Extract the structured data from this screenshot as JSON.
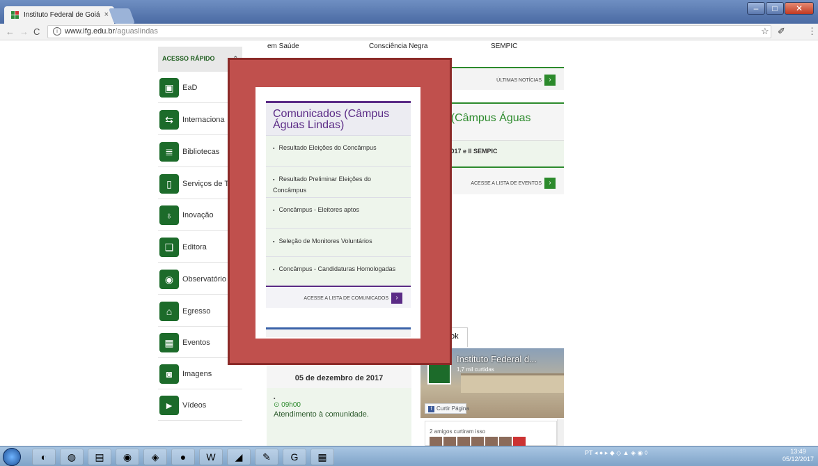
{
  "browser": {
    "tab_title": "Instituto Federal de Goiá",
    "tab_close": "×",
    "url_domain": "www.ifg.edu.br",
    "url_path": "/aguaslindas",
    "back": "←",
    "forward": "→",
    "reload": "C",
    "info": "i",
    "star": "☆",
    "menu": "⋮"
  },
  "top_text": {
    "col1": "em Saúde",
    "col2": "Consciência Negra",
    "col3": "SEMPIC"
  },
  "sidebar": {
    "header": "ACESSO RÁPIDO",
    "caret": "⌃",
    "items": [
      {
        "label": "EaD",
        "icon": "▣"
      },
      {
        "label": "Internaciona",
        "icon": "⇆"
      },
      {
        "label": "Bibliotecas",
        "icon": "≣"
      },
      {
        "label": "Serviços de T",
        "icon": "▯"
      },
      {
        "label": "Inovação",
        "icon": "♁"
      },
      {
        "label": "Editora",
        "icon": "❑"
      },
      {
        "label": "Observatório",
        "icon": "◉"
      },
      {
        "label": "Egresso",
        "icon": "⌂"
      },
      {
        "label": "Eventos",
        "icon": "▦"
      },
      {
        "label": "Imagens",
        "icon": "◙"
      },
      {
        "label": "Vídeos",
        "icon": "►"
      }
    ]
  },
  "noticias": {
    "link": "ÚLTIMAS NOTÍCIAS",
    "arrow": "›"
  },
  "eventos": {
    "title": "tos (Câmpus Águas\ns)",
    "item": "TEC 2017 e II SEMPIC",
    "link": "ACESSE A LISTA DE EVENTOS",
    "arrow": "›"
  },
  "comunicados": {
    "title": "Comunicados (Câmpus Águas Lindas)",
    "items": [
      "Resultado Eleições do Concâmpus",
      "Resultado Preliminar Eleições do Concâmpus",
      "Concâmpus - Eleitores aptos",
      "Seleção de Monitores Voluntários",
      "Concâmpus - Candidaturas Homologadas"
    ],
    "bullet": "▪",
    "link": "ACESSE A LISTA DE COMUNICADOS",
    "arrow": "›"
  },
  "agenda": {
    "date": "05 de dezembro de 2017",
    "bullet": "▪",
    "time": "⊙ 09h00",
    "item": "Atendimento à comunidade."
  },
  "facebook": {
    "tab": "ok",
    "page_name": "Instituto Federal d...",
    "likes": "1,7 mil curtidas",
    "like_button": "Curtir Página",
    "friends": "2 amigos curtiram isso"
  },
  "taskbar": {
    "lang": "PT",
    "time": "13:49",
    "date": "05/12/2017",
    "apps": [
      "◐",
      "◍",
      "▤",
      "◉",
      "◈",
      "●",
      "◕",
      "W",
      "◢",
      "✎",
      "G",
      "▦"
    ]
  }
}
